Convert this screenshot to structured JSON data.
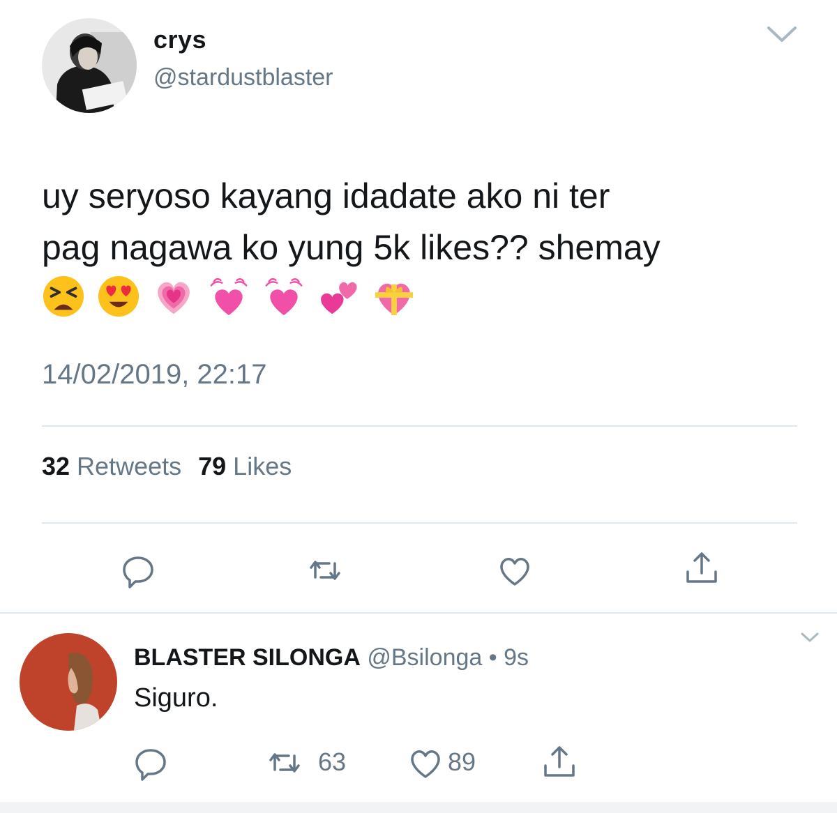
{
  "tweet": {
    "name": "crys",
    "handle": "@stardustblaster",
    "text_line1": "uy seryoso kayang idadate ako ni ter",
    "text_line2": "pag nagawa ko yung 5k likes?? shemay",
    "emojis": [
      "tired-face",
      "heart-eyes-face",
      "growing-heart",
      "beating-heart",
      "beating-heart",
      "two-hearts",
      "heart-with-ribbon"
    ],
    "timestamp": "14/02/2019, 22:17",
    "retweets_count": "32",
    "retweets_label": "Retweets",
    "likes_count": "79",
    "likes_label": "Likes"
  },
  "reply": {
    "name": "BLASTER SILONGA",
    "handle": "@Bsilonga",
    "dot": "•",
    "time": "9s",
    "text": "Siguro.",
    "retweets": "63",
    "likes": "89"
  },
  "colors": {
    "text": "#14171a",
    "secondary": "#657786",
    "divider": "#e1e8ed",
    "heart_pink": "#f06aa8",
    "avatar_orange": "#c2492e"
  }
}
